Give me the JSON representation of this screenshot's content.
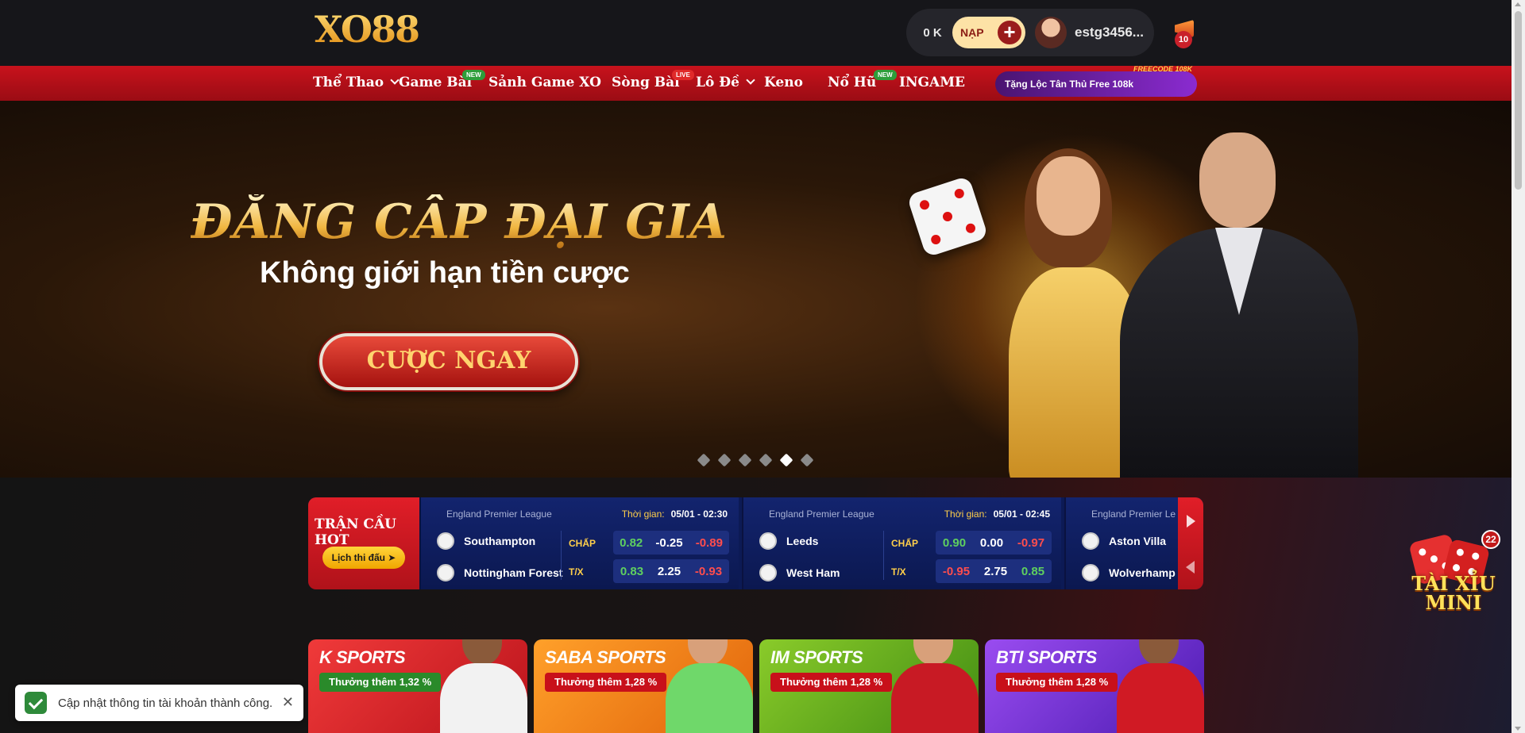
{
  "header": {
    "logo_text": "XO88",
    "balance": "0 K",
    "deposit_label": "NẠP",
    "username": "estg3456...",
    "notification_count": "10"
  },
  "nav": {
    "items": [
      {
        "label": "Thể Thao",
        "has_dropdown": true
      },
      {
        "label": "Game Bài",
        "tag": "NEW"
      },
      {
        "label": "Sảnh Game XO"
      },
      {
        "label": "Sòng Bài",
        "tag": "LIVE"
      },
      {
        "label": "Lô Đề",
        "has_dropdown": true
      },
      {
        "label": "Keno"
      },
      {
        "label": "Nổ Hũ",
        "tag": "NEW"
      },
      {
        "label": "INGAME"
      }
    ],
    "promo": {
      "label": "Tặng Lộc Tân Thủ Free 108k",
      "code": "FREECODE 108K"
    }
  },
  "hero": {
    "headline": "ĐẲNG CẤP ĐẠI GIA",
    "subline": "Không giới hạn tiền cược",
    "cta": "CƯỢC NGAY",
    "slides_total": 6,
    "slide_active": 5
  },
  "hot_matches": {
    "title": "TRẬN CẦU HOT",
    "schedule_button": "Lịch thi đấu ➤",
    "time_label": "Thời gian:",
    "handicap_label": "CHẤP",
    "ou_label": "T/X",
    "matches": [
      {
        "league": "England Premier League",
        "time": "05/01 - 02:30",
        "home": "Southampton",
        "away": "Nottingham Forest",
        "handicap": [
          "0.82",
          "-0.25",
          "-0.89"
        ],
        "over_under": [
          "0.83",
          "2.25",
          "-0.93"
        ]
      },
      {
        "league": "England Premier League",
        "time": "05/01 - 02:45",
        "home": "Leeds",
        "away": "West Ham",
        "handicap": [
          "0.90",
          "0.00",
          "-0.97"
        ],
        "over_under": [
          "-0.95",
          "2.75",
          "0.85"
        ]
      },
      {
        "league": "England Premier Le",
        "time": "",
        "home": "Aston Villa",
        "away": "Wolverhamp",
        "handicap": [
          "",
          "",
          ""
        ],
        "over_under": [
          "",
          "",
          ""
        ]
      }
    ]
  },
  "sports": [
    {
      "title": "K SPORTS",
      "bonus": "Thưởng thêm 1,32 %"
    },
    {
      "title": "SABA SPORTS",
      "bonus": "Thưởng thêm 1,28 %"
    },
    {
      "title": "IM SPORTS",
      "bonus": "Thưởng thêm 1,28 %"
    },
    {
      "title": "BTI SPORTS",
      "bonus": "Thưởng thêm 1,28 %"
    }
  ],
  "taixiu": {
    "label": "TÀI XỈU MINI",
    "count": "22"
  },
  "toast": {
    "message": "Cập nhật thông tin tài khoản thành công."
  },
  "colors": {
    "nav_red": "#c8121c",
    "accent_gold": "#f0b640",
    "hot_blue": "#0c1a55"
  }
}
